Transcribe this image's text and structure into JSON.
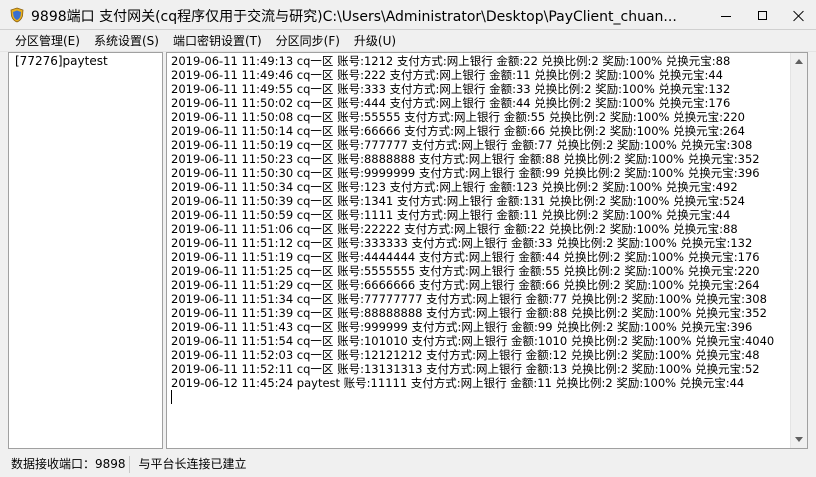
{
  "window": {
    "title": "9898端口 支付网关(cq程序仅用于交流与研究)C:\\Users\\Administrator\\Desktop\\PayClient_chuan..."
  },
  "menu": {
    "items": [
      "分区管理(E)",
      "系统设置(S)",
      "端口密钥设置(T)",
      "分区同步(F)",
      "升级(U)"
    ]
  },
  "partitions": {
    "items": [
      "[77276]paytest"
    ]
  },
  "log": {
    "lines": [
      "2019-06-11 11:49:13  cq一区  账号:1212  支付方式:网上银行  金额:22  兑换比例:2  奖励:100%  兑换元宝:88",
      "2019-06-11 11:49:46  cq一区  账号:222  支付方式:网上银行  金额:11  兑换比例:2  奖励:100%  兑换元宝:44",
      "2019-06-11 11:49:55  cq一区  账号:333  支付方式:网上银行  金额:33  兑换比例:2  奖励:100%  兑换元宝:132",
      "2019-06-11 11:50:02  cq一区  账号:444  支付方式:网上银行  金额:44  兑换比例:2  奖励:100%  兑换元宝:176",
      "2019-06-11 11:50:08  cq一区  账号:55555  支付方式:网上银行  金额:55  兑换比例:2  奖励:100%  兑换元宝:220",
      "2019-06-11 11:50:14  cq一区  账号:66666  支付方式:网上银行  金额:66  兑换比例:2  奖励:100%  兑换元宝:264",
      "2019-06-11 11:50:19  cq一区  账号:777777  支付方式:网上银行  金额:77  兑换比例:2  奖励:100%  兑换元宝:308",
      "2019-06-11 11:50:23  cq一区  账号:8888888  支付方式:网上银行  金额:88  兑换比例:2  奖励:100%  兑换元宝:352",
      "2019-06-11 11:50:30  cq一区  账号:9999999  支付方式:网上银行  金额:99  兑换比例:2  奖励:100%  兑换元宝:396",
      "2019-06-11 11:50:34  cq一区  账号:123  支付方式:网上银行  金额:123  兑换比例:2  奖励:100%  兑换元宝:492",
      "2019-06-11 11:50:39  cq一区  账号:1341  支付方式:网上银行  金额:131  兑换比例:2  奖励:100%  兑换元宝:524",
      "2019-06-11 11:50:59  cq一区  账号:1111  支付方式:网上银行  金额:11  兑换比例:2  奖励:100%  兑换元宝:44",
      "2019-06-11 11:51:06  cq一区  账号:22222  支付方式:网上银行  金额:22  兑换比例:2  奖励:100%  兑换元宝:88",
      "2019-06-11 11:51:12  cq一区  账号:333333  支付方式:网上银行  金额:33  兑换比例:2  奖励:100%  兑换元宝:132",
      "2019-06-11 11:51:19  cq一区  账号:4444444  支付方式:网上银行  金额:44  兑换比例:2  奖励:100%  兑换元宝:176",
      "2019-06-11 11:51:25  cq一区  账号:5555555  支付方式:网上银行  金额:55  兑换比例:2  奖励:100%  兑换元宝:220",
      "2019-06-11 11:51:29  cq一区  账号:6666666  支付方式:网上银行  金额:66  兑换比例:2  奖励:100%  兑换元宝:264",
      "2019-06-11 11:51:34  cq一区  账号:77777777  支付方式:网上银行  金额:77  兑换比例:2  奖励:100%  兑换元宝:308",
      "2019-06-11 11:51:39  cq一区  账号:88888888  支付方式:网上银行  金额:88  兑换比例:2  奖励:100%  兑换元宝:352",
      "2019-06-11 11:51:43  cq一区  账号:999999  支付方式:网上银行  金额:99  兑换比例:2  奖励:100%  兑换元宝:396",
      "2019-06-11 11:51:54  cq一区  账号:101010  支付方式:网上银行  金额:1010  兑换比例:2  奖励:100%  兑换元宝:4040",
      "2019-06-11 11:52:03  cq一区  账号:12121212  支付方式:网上银行  金额:12  兑换比例:2  奖励:100%  兑换元宝:48",
      "2019-06-11 11:52:11  cq一区  账号:13131313  支付方式:网上银行  金额:13  兑换比例:2  奖励:100%  兑换元宝:52",
      "2019-06-12 11:45:24  paytest  账号:11111  支付方式:网上银行  金额:11  兑换比例:2  奖励:100%  兑换元宝:44"
    ]
  },
  "status": {
    "port": "数据接收端口：9898",
    "connection": "与平台长连接已建立"
  }
}
